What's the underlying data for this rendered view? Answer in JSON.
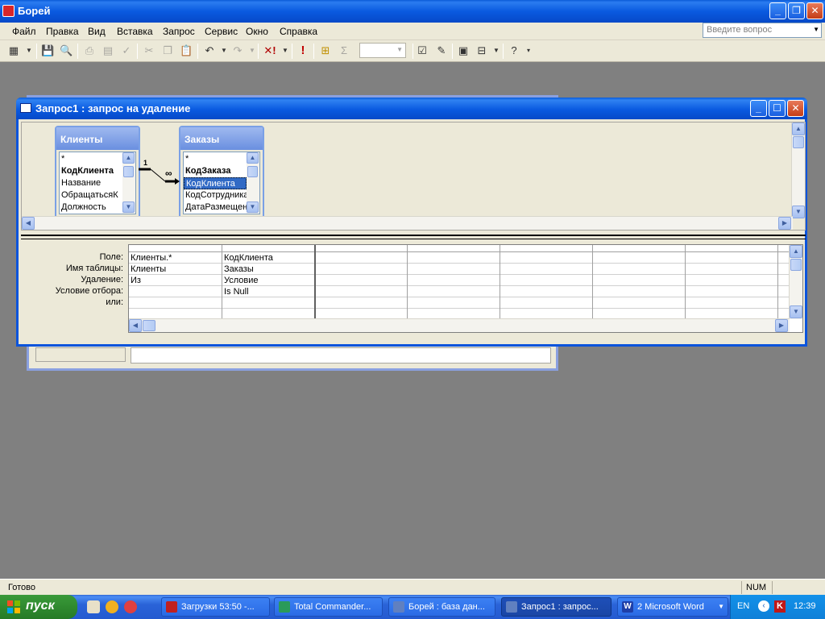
{
  "app": {
    "title": "Борей"
  },
  "menu": [
    "Файл",
    "Правка",
    "Вид",
    "Вставка",
    "Запрос",
    "Сервис",
    "Окно",
    "Справка"
  ],
  "ask": {
    "placeholder": "Введите вопрос"
  },
  "query_window": {
    "title": "Запрос1 : запрос на удаление",
    "tables": [
      {
        "name": "Клиенты",
        "fields": [
          "*",
          "КодКлиента",
          "Название",
          "ОбращатьсяК",
          "Должность"
        ],
        "bold_field": 1
      },
      {
        "name": "Заказы",
        "fields": [
          "*",
          "КодЗаказа",
          "КодКлиента",
          "КодСотрудника",
          "ДатаРазмещени"
        ],
        "bold_field": 1,
        "selected_field": 2
      }
    ],
    "relation": {
      "one": "1",
      "many": "∞"
    },
    "grid": {
      "row_labels": [
        "Поле:",
        "Имя таблицы:",
        "Удаление:",
        "Условие отбора:",
        "или:"
      ],
      "columns": [
        {
          "field": "Клиенты.*",
          "table": "Клиенты",
          "delete": "Из",
          "criteria": "",
          "or": ""
        },
        {
          "field": "КодКлиента",
          "table": "Заказы",
          "delete": "Условие",
          "criteria": "Is Null",
          "or": ""
        }
      ]
    }
  },
  "status": {
    "text": "Готово",
    "num": "NUM"
  },
  "taskbar": {
    "start": "пуск",
    "tasks": [
      {
        "label": "Загрузки 53:50 -...",
        "color": "#c02020"
      },
      {
        "label": "Total Commander...",
        "color": "#2a9a5a"
      },
      {
        "label": "Борей : база дан...",
        "color": "#6080c0"
      },
      {
        "label": "Запрос1 : запрос...",
        "color": "#6080c0",
        "active": true
      },
      {
        "label": "2 Microsoft Word",
        "color": "#1e3fa8"
      }
    ],
    "lang": "EN",
    "clock": "12:39"
  }
}
